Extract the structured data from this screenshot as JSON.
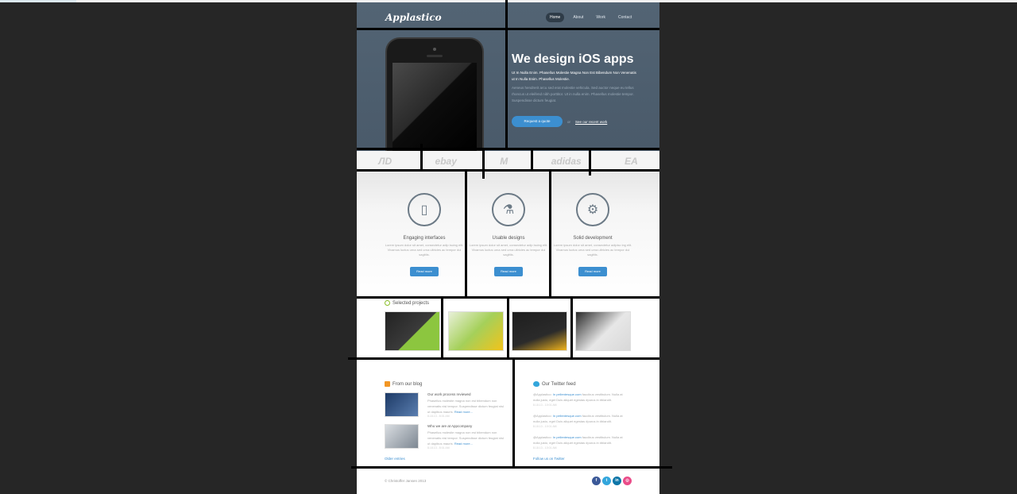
{
  "header": {
    "logo": "Applastico",
    "nav": [
      "Home",
      "About",
      "Work",
      "Contact"
    ]
  },
  "hero": {
    "title": "We design iOS apps",
    "subtitle": "Ut In Nulla Enim. Phasellus Molestie Magna Non Est Bibendum Non Venenatis ut In Nulla Enim. Phasellus Molestie.",
    "body": "Aeneus hendrerit arcu sed erat molestie vehicula. Sed auctor neque eu tellus rhoncus ut eleifend nibh porttitor. Ut in nulla enim. Phasellus molestie tempor. Suspendisse dictum feugiat.",
    "cta": "Request a quote",
    "or": "or",
    "secondary": "See our recent work"
  },
  "clients": [
    "ЛD",
    "ebay",
    "M",
    "adidas",
    "EA"
  ],
  "features": [
    {
      "icon": "phone-icon",
      "glyph": "▯",
      "title": "Engaging interfaces",
      "desc": "Lorem ipsum dolor sit amet, consectetur adip iscing elit. Vivamus luctus urna sed urna ultricies ac tempor dui sagittis.",
      "button": "Read more"
    },
    {
      "icon": "flask-icon",
      "glyph": "⚗",
      "title": "Usable designs",
      "desc": "Lorem ipsum dolor sit amet, consectetur adip iscing elit. Vivamus luctus urna sed urna ultricies ac tempor dui sagittis.",
      "button": "Read more"
    },
    {
      "icon": "gears-icon",
      "glyph": "⚙",
      "title": "Solid development",
      "desc": "Lorem ipsum dolor sit amet, consectetur adipisc ing elit. Vivamus luctus urna sed urna ultricies ac tempor dui sagittis.",
      "button": "Read more"
    }
  ],
  "projects": {
    "title": "Selected projects"
  },
  "blog": {
    "title": "From our blog",
    "posts": [
      {
        "title": "Our work process reviewed",
        "body": "Phasellus molestie magna non est bibendum non venenatis nisl tempor. Suspendisse dictum feugiat nisl ut dapibus mauris.",
        "more": "Read more...",
        "meta": "8.18.13 - 8:01 AM"
      },
      {
        "title": "Who we are at Appcompany",
        "body": "Phasellus molestie magna non est bibendum non venenatis nisl tempor. Suspendisse dictum feugiat nisl ut dapibus mauris.",
        "more": "Read more...",
        "meta": "8.18.13 - 8:01 AM"
      }
    ],
    "older": "Older entries"
  },
  "twitter": {
    "title": "Our Twitter feed",
    "tweets": [
      {
        "handle": "@Applastico:",
        "link": "In pellentesque.com",
        "text": "faucibus vestibulum. Nulla at nulla justo, eget Duis aliquet egestas #purus in #blandit.",
        "meta": "8.18.13 - 10:01 AM"
      },
      {
        "handle": "@Applastico:",
        "link": "In pellentesque.com",
        "text": "faucibus vestibulum. Nulla at nulla justo, eget Duis aliquet egestas #purus in #blandit.",
        "meta": "8.18.13 - 10:01 AM"
      },
      {
        "handle": "@Applastico:",
        "link": "In pellentesque.com",
        "text": "faucibus vestibulum. Nulla at nulla justo, eget Duis aliquet egestas #purus in #blandit.",
        "meta": "8.18.13 - 10:01 AM"
      }
    ],
    "follow": "Follow us on Twitter"
  },
  "footer": {
    "copyright": "© Christoffer Jansen 2013",
    "socials": [
      {
        "name": "facebook-icon",
        "glyph": "f",
        "color": "#3b5998"
      },
      {
        "name": "twitter-icon",
        "glyph": "t",
        "color": "#33a6dc"
      },
      {
        "name": "linkedin-icon",
        "glyph": "in",
        "color": "#0e76a8"
      },
      {
        "name": "dribbble-icon",
        "glyph": "◎",
        "color": "#ea4c89"
      }
    ]
  }
}
